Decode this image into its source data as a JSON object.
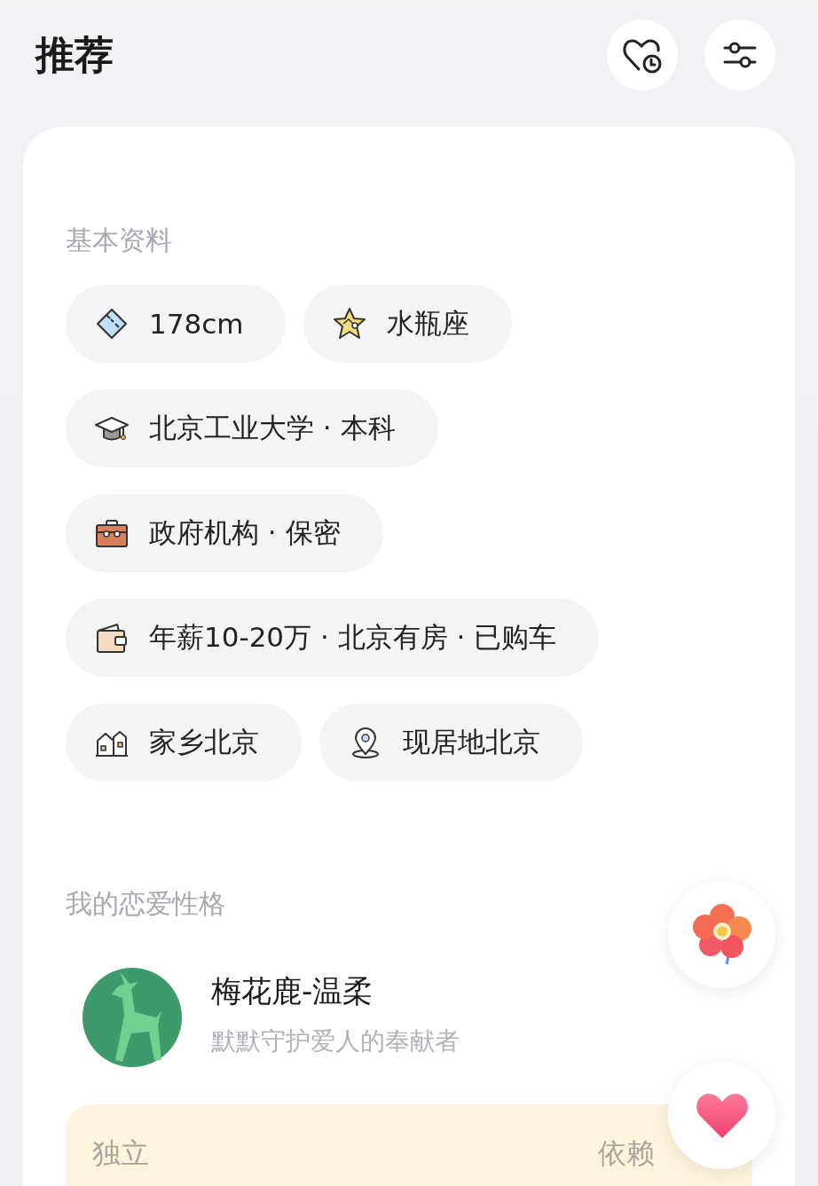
{
  "header": {
    "title": "推荐"
  },
  "basic_info": {
    "heading": "基本资料",
    "chips": [
      {
        "kind": "height",
        "text": "178cm"
      },
      {
        "kind": "zodiac",
        "text": "水瓶座"
      },
      {
        "kind": "education",
        "text": "北京工业大学 · 本科"
      },
      {
        "kind": "job",
        "text": "政府机构 · 保密"
      },
      {
        "kind": "income",
        "text": "年薪10-20万 · 北京有房 · 已购车"
      },
      {
        "kind": "hometown",
        "text": "家乡北京"
      },
      {
        "kind": "residence",
        "text": "现居地北京"
      }
    ]
  },
  "personality": {
    "heading": "我的恋爱性格",
    "name": "梅花鹿-温柔",
    "description": "默默守护爱人的奉献者",
    "scale_left": "独立",
    "scale_right": "依赖"
  }
}
